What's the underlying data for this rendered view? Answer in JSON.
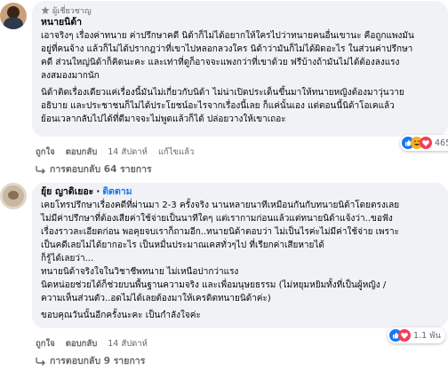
{
  "comment1": {
    "badge": "ผู้เชี่ยวชาญ",
    "author": "หนายนิด้า",
    "body": [
      "เอาจริงๆ เรื่องค่าทนาย ค่าปรึกษาคดี นิด้าก็ไม่ได้อยากให้ใครไปว่าทนายคนอื่นเขานะ คือถูกแพงมัน\nอยู่ที่คนจ้าง แล้วก็ไม่ได้ปรากฎว่าที่เขาไปหลอกลวงใคร นิด้าว่ามันก็ไม่ได้ผิดอะไร ในส่วนค่าปรึกษา\nคดี ส่วนใหญ่นิด้าก็คิดนะคะ และเท่าที่ดูก็อาจจะแพงกว่าที่เขาด้วย ฟรีบ้างถ้ามันไม่ได้ต้องลงแรง\nลงสมองมากนัก",
      "นิด้าติดเรื่องเดียวแค่เรื่องนี้มันไม่เกี่ยวกับนิด้า ไม่น่าเปิดประเด็นขึ้นมาให้ทนายหญิงต้องมาวุ่นวาย\nอธิบาย และประชาชนก็ไม่ได้ประโยชน์อะไรจากเรื่องนี้เลย ก็แค่นั้นเอง แต่ตอนนี้นิด้าโอเคแล้ว\nย้อนเวลากลับไปได้ที่ดีมาจจะไม่พูดแล้วก็ได้ ปล่อยวางให้เขาเถอะ"
    ],
    "actions": {
      "like": "ถูกใจ",
      "reply": "ตอบกลับ",
      "time": "14 สัปดาห์",
      "edited": "แก้ไขแล้ว"
    },
    "reaction_count": "465",
    "replies": "การตอบกลับ 64 รายการ"
  },
  "comment2": {
    "author": "ยุ้ย ญาดิเยอะ",
    "follow": "ติดตาม",
    "body": [
      "เคยโทรปรึกษาเรื่องคดีที่ผ่านมา 2-3 ครั้งจริง นานหลายนาทีเหมือนกันกับทนายนิด้าโดยตรงเลย\nไม่มีค่าปรึกษาที่ต้องเสียค่าใช้จ่ายเป็นนาทีใดๆ แต่เรากามก่อนแล้วแต่ทนายนิด้าแจ้งว่า..ขอฟัง\nเรื่องราวละเอียดก่อน พอคุยจบเราก็ถามอีก..ทนายนิด้าตอบว่า ไม่เป็นไรค่ะไม่มีค่าใช้จ่าย เพราะ\nเป็นคดีเลยไม่ได้ยากอะไร เป็นหมื่นประมาณเคสทั่วๆไป ที่เรียกค่าเสียหายได้\nก็รู้ได้เลยว่า...\nทนายนิด้าจริงใจในวิชาชีพทนาย ไม่เหนือปากว่าแรง\nนิดหน่อยช่วยได้ก็ช่วยบนพื้นฐานความจริง และเพื่อมนุษยธรรม (ไม่หยุมหยิมทั้งที่เป็นผู้หญิง /\nความเห็นส่วนตัว..อดไม่ได้เลยต้องมาให้เครดิตทนายนิด้าค่ะ)",
      "ขอบคุณวันนั้นอีกครั้งนะคะ เป็นกำลังใจค่ะ"
    ],
    "actions": {
      "like": "ถูกใจ",
      "reply": "ตอบกลับ",
      "time": "14 สัปดาห์"
    },
    "reaction_count": "1.1 พัน",
    "replies": "การตอบกลับ 9 รายการ"
  },
  "colors": {
    "bubble": "#f0f2f5",
    "meta": "#65676b",
    "link": "#1877f2"
  },
  "icons": [
    "expert-badge-icon",
    "reply-arrow-icon",
    "like-reaction-icon",
    "haha-reaction-icon",
    "love-reaction-icon"
  ]
}
